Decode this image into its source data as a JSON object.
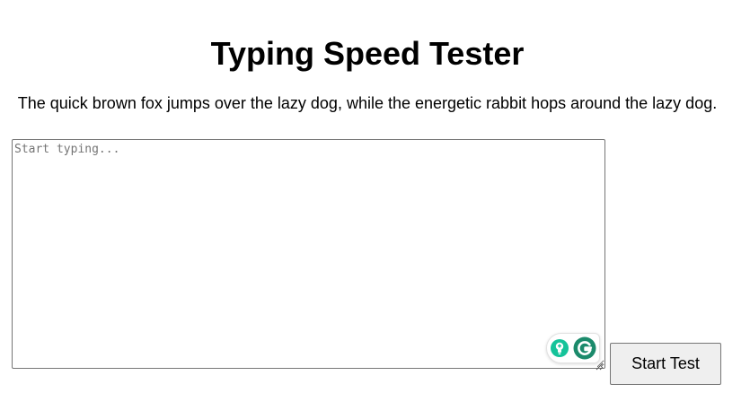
{
  "page": {
    "title": "Typing Speed Tester",
    "sentence": "The quick brown fox jumps over the lazy dog, while the energetic rabbit hops around the lazy dog."
  },
  "input": {
    "value": "",
    "placeholder": "Start typing..."
  },
  "actions": {
    "start_label": "Start Test"
  },
  "icons": {
    "assistant": [
      "lightbulb-icon",
      "grammarly-icon"
    ],
    "resize": "resize-grip-icon"
  },
  "colors": {
    "grammarly_green": "#15C39A",
    "grammarly_dark_green": "#1b8a6b",
    "button_bg": "#efefef",
    "border": "#767676"
  }
}
